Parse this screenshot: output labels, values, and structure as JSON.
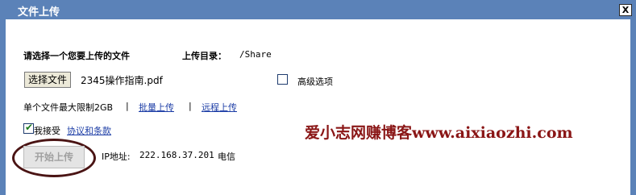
{
  "dialog": {
    "title": "文件上传",
    "close_icon": "X"
  },
  "form": {
    "prompt": "请选择一个您要上传的文件",
    "upload_dir_label": "上传目录：",
    "upload_dir_value": "/Share",
    "choose_file_label": "选择文件",
    "selected_file": "2345操作指南.pdf",
    "advanced_label": "高级选项",
    "advanced_checked": false,
    "limit_text": "单个文件最大限制2GB",
    "separator": "|",
    "batch_upload_link": "批量上传",
    "remote_upload_link": "远程上传",
    "agree_label": "我接受",
    "agree_checked": true,
    "terms_link": "协议和条款",
    "start_button": "开始上传",
    "ip_label": "IP地址:",
    "ip_value": "222.168.37.201",
    "isp": "电信"
  },
  "watermark": "爱小志网赚博客www.aixiaozhi.com"
}
